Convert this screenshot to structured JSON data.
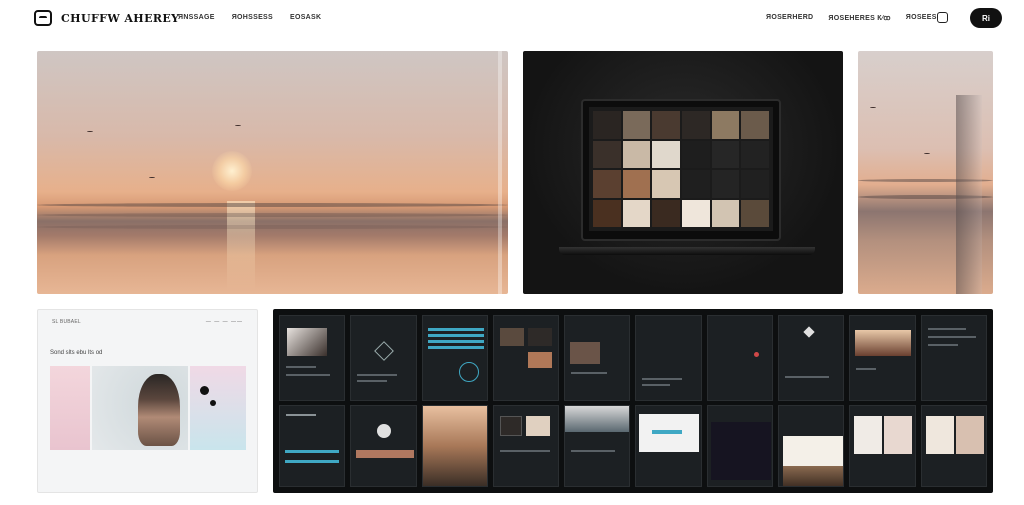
{
  "header": {
    "brand": "CHUFFW AHEREY",
    "nav_left": [
      "ЯNSSAGE",
      "ЯOHSSESS",
      "EOSASK"
    ],
    "nav_right": [
      "ЯOSERHERD",
      "ЯOSEHERES К⁄ꝏ",
      "ЯOSEES"
    ],
    "cta_label": "Ri",
    "cta_icon": "user-icon",
    "utility_icon": "bookmark-icon"
  },
  "web_preview": {
    "top_left": "SL BUBAEL",
    "top_right": "— — — ——",
    "headline": "Sond slts ebu lts od"
  },
  "colors": {
    "accent_cyan": "#3fa8c4",
    "dark_panel": "#0d0f10",
    "cta_background": "#111111"
  }
}
